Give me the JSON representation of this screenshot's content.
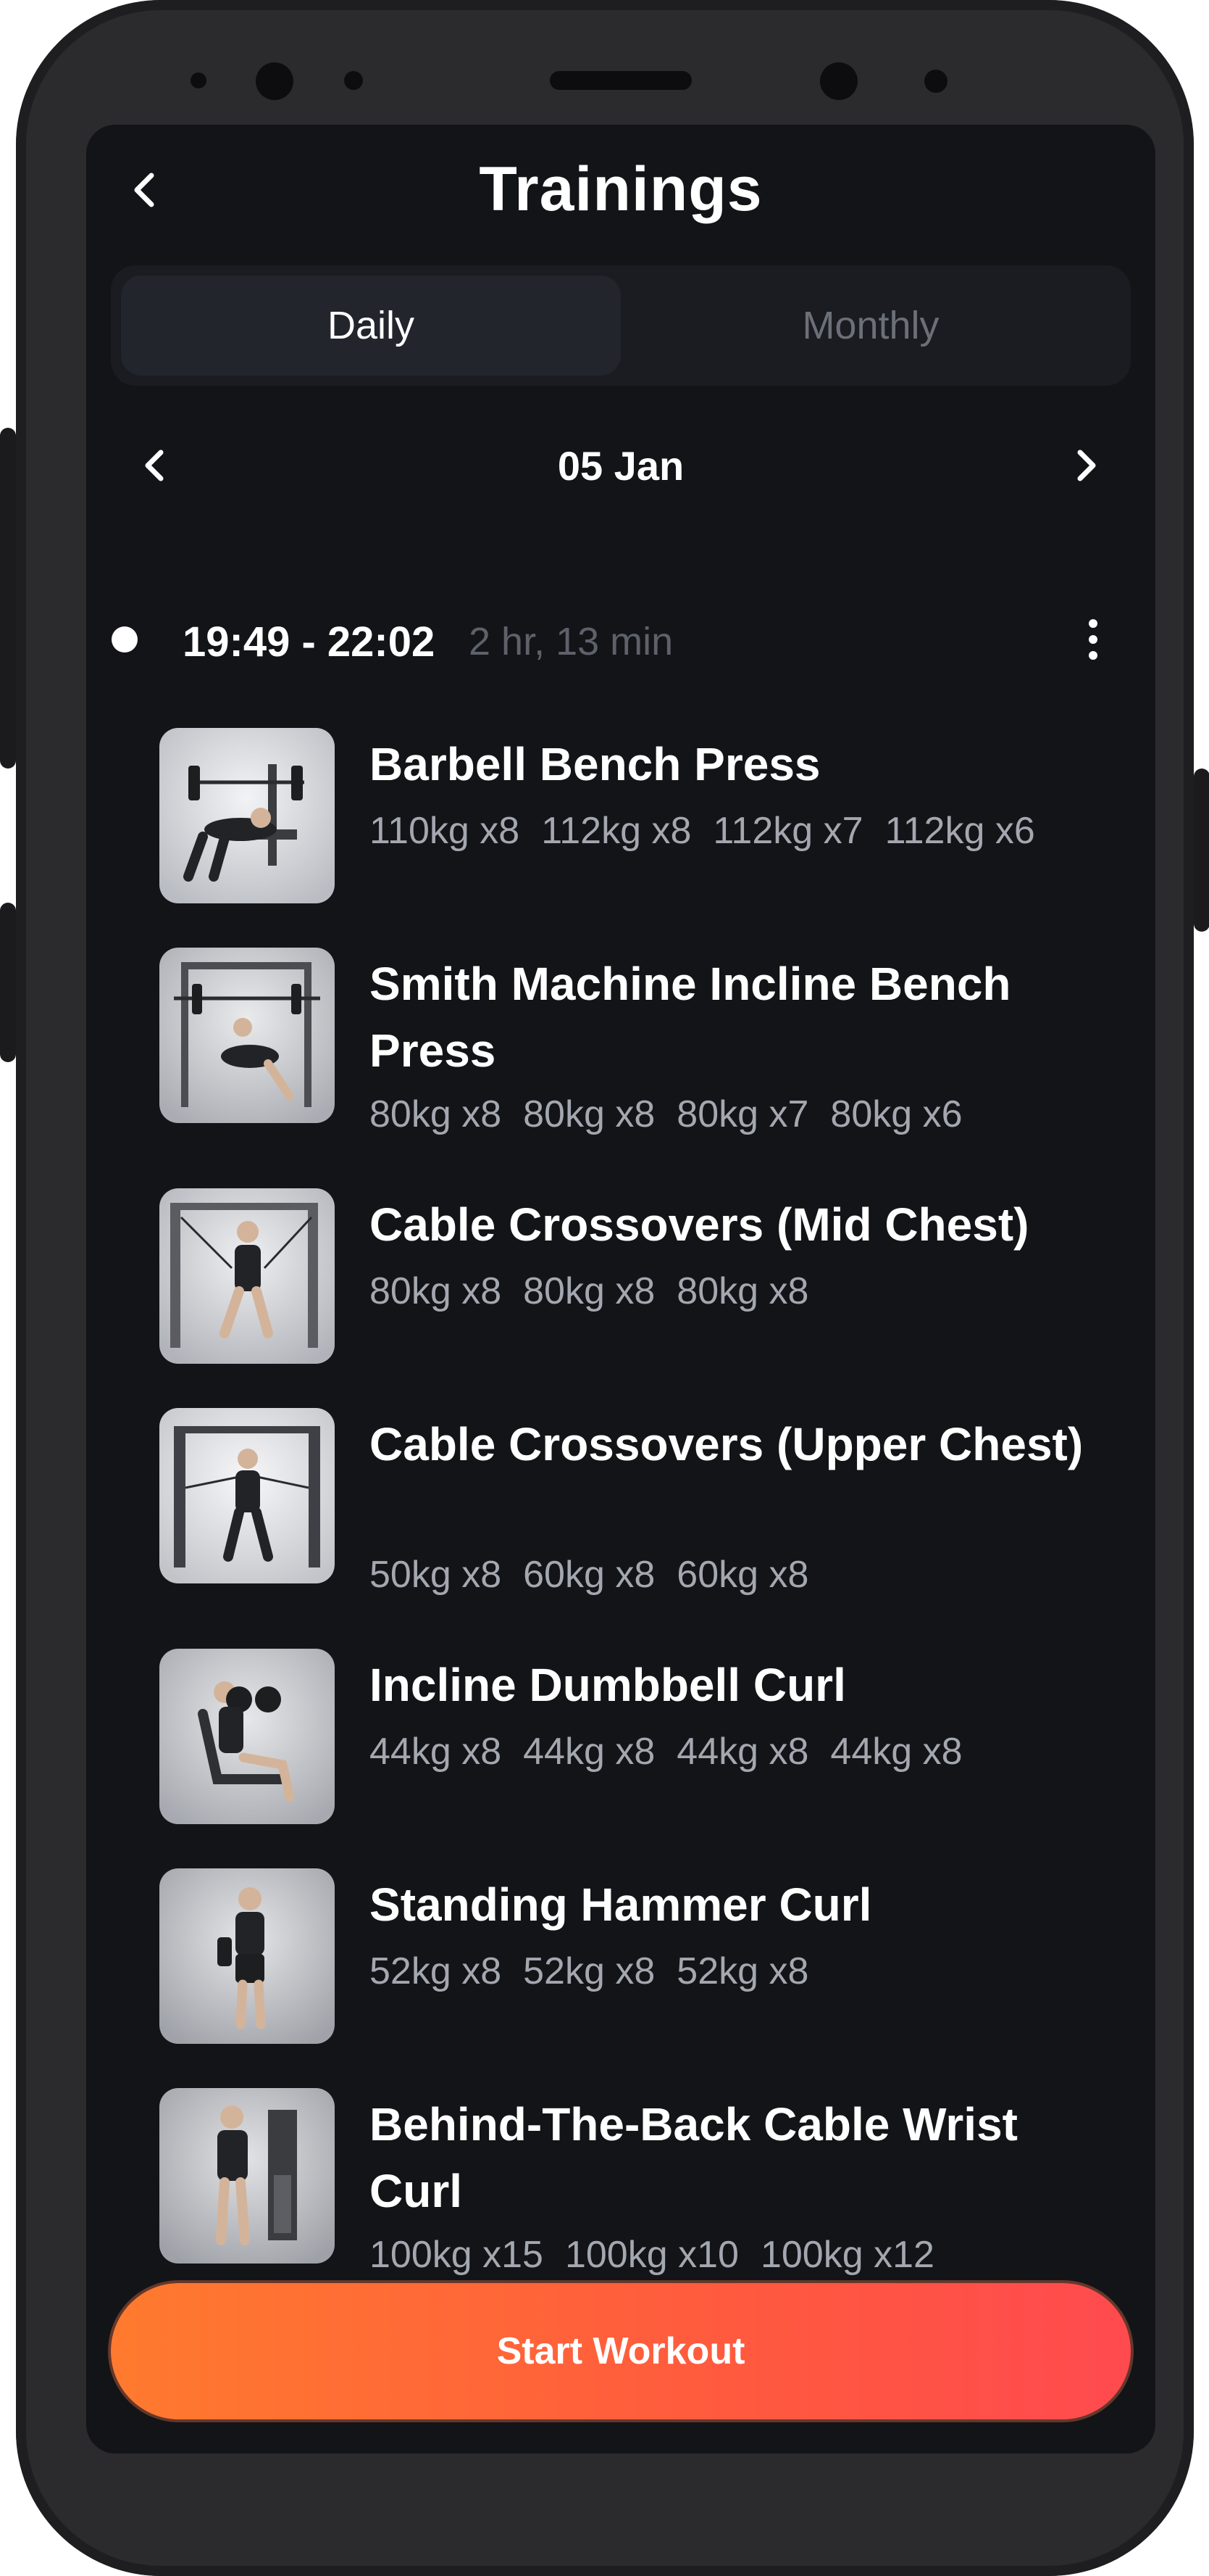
{
  "header": {
    "title": "Trainings",
    "back_icon": "chevron-left-icon"
  },
  "tabs": [
    {
      "label": "Daily",
      "active": true
    },
    {
      "label": "Monthly",
      "active": false
    }
  ],
  "date_nav": {
    "date": "05 Jan",
    "prev_icon": "chevron-left-icon",
    "next_icon": "chevron-right-icon"
  },
  "session": {
    "time_range": "19:49 - 22:02",
    "duration": "2 hr, 13 min",
    "menu_icon": "more-vertical-icon"
  },
  "exercises": [
    {
      "name": "Barbell Bench Press",
      "sets": [
        "110kg x8",
        "112kg x8",
        "112kg x7",
        "112kg x6"
      ]
    },
    {
      "name": "Smith Machine Incline Bench Press",
      "sets": [
        "80kg x8",
        "80kg x8",
        "80kg x7",
        "80kg x6"
      ]
    },
    {
      "name": "Cable Crossovers (Mid Chest)",
      "sets": [
        "80kg x8",
        "80kg x8",
        "80kg x8"
      ]
    },
    {
      "name": "Cable Crossovers (Upper Chest)",
      "sets": [
        "50kg x8",
        "60kg x8",
        "60kg x8"
      ]
    },
    {
      "name": "Incline Dumbbell Curl",
      "sets": [
        "44kg x8",
        "44kg x8",
        "44kg x8",
        "44kg x8"
      ]
    },
    {
      "name": "Standing Hammer Curl",
      "sets": [
        "52kg x8",
        "52kg x8",
        "52kg x8"
      ]
    },
    {
      "name": "Behind-The-Back Cable Wrist Curl",
      "sets": [
        "100kg x15",
        "100kg x10",
        "100kg x12"
      ]
    }
  ],
  "cta": {
    "label": "Start Workout"
  },
  "colors": {
    "background": "#131417",
    "accent_start": "#ff7a2e",
    "accent_end": "#ff4a4f",
    "muted_text": "#a3a7b0"
  }
}
